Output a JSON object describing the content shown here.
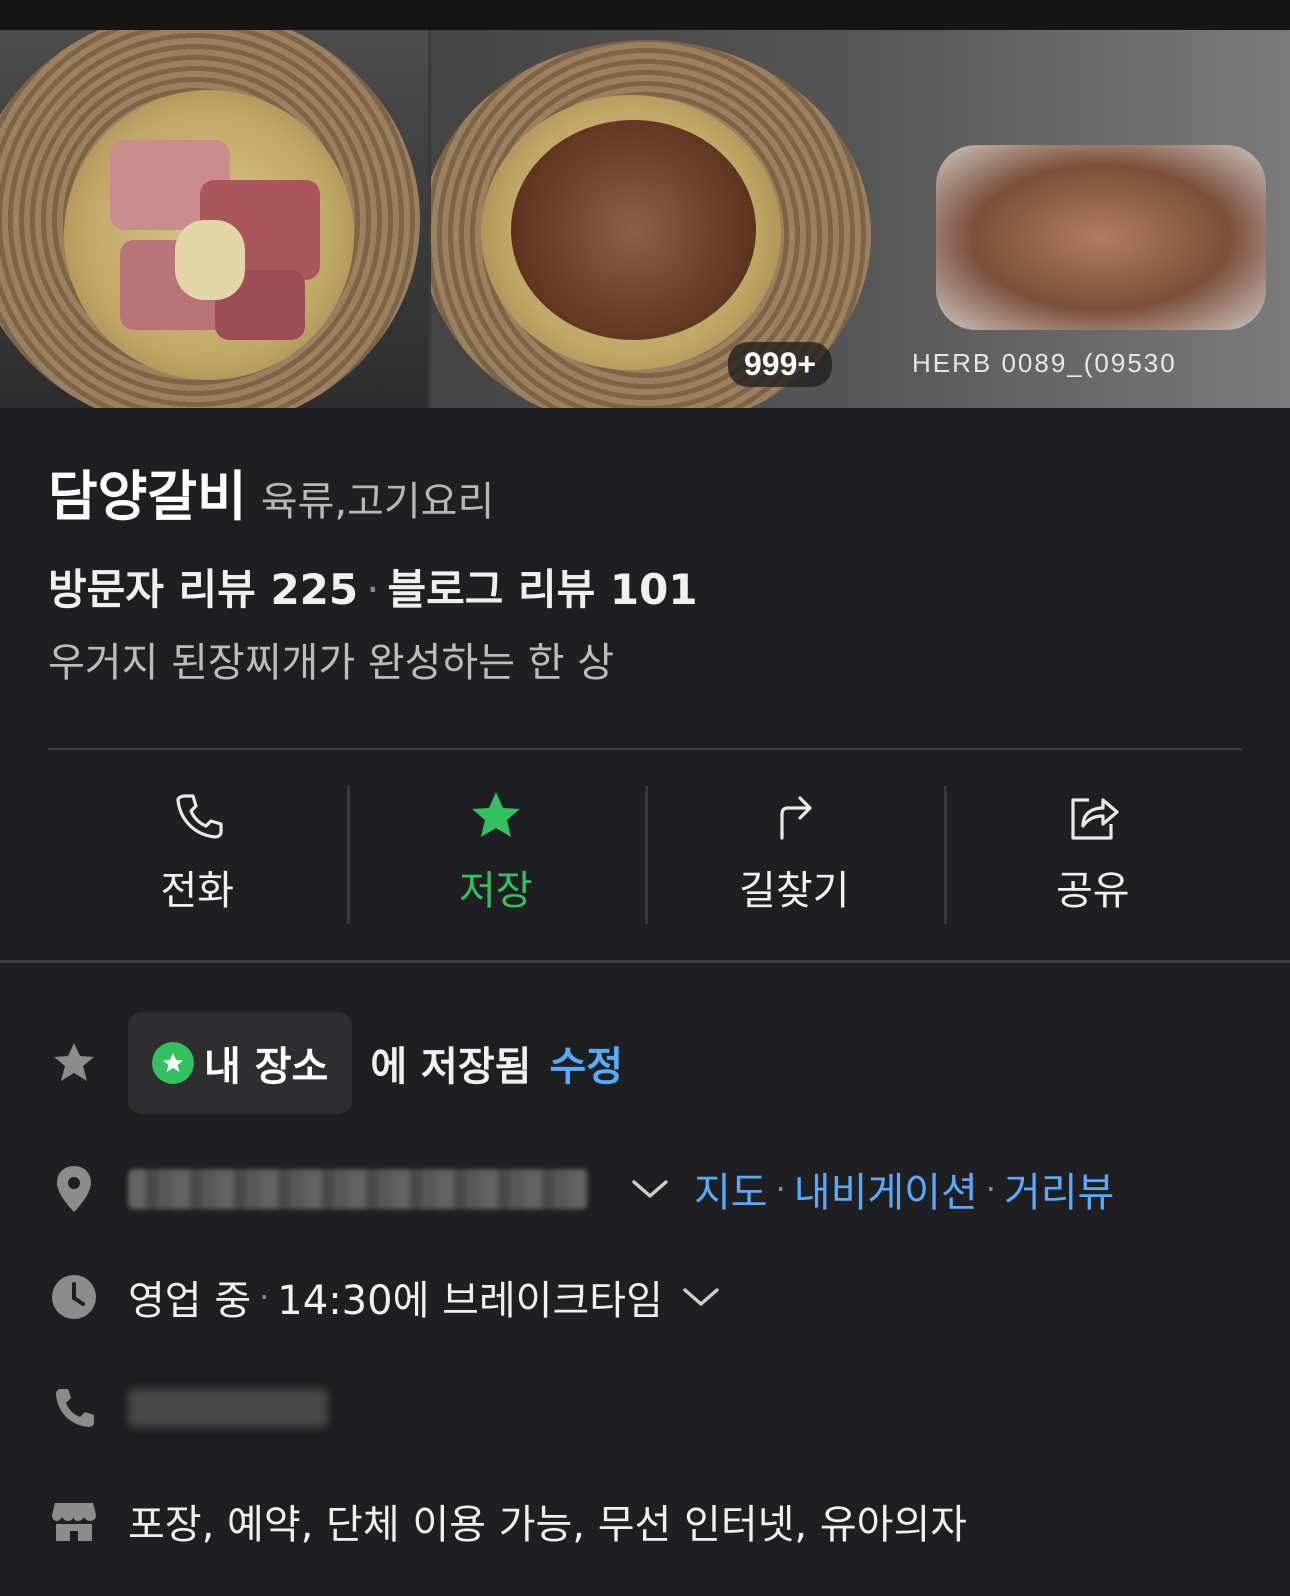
{
  "gallery": {
    "photo_count_badge": "999+",
    "photo_credit": "HERB 0089_(09530",
    "photos": [
      "raw-beef-rib-plate-photo",
      "marinated-galbi-plate-photo",
      "galbi-packaging-photo"
    ]
  },
  "place": {
    "name": "담양갈비",
    "category": "육류,고기요리",
    "visitor_reviews_label": "방문자 리뷰 225",
    "review_separator": "·",
    "blog_reviews_label": "블로그 리뷰 101",
    "description": "우거지 된장찌개가 완성하는 한 상"
  },
  "actions": [
    {
      "label": "전화",
      "icon": "phone-icon"
    },
    {
      "label": "저장",
      "icon": "star-icon"
    },
    {
      "label": "길찾기",
      "icon": "directions-icon"
    },
    {
      "label": "공유",
      "icon": "share-icon"
    }
  ],
  "saved": {
    "chip_label": "내 장소",
    "saved_text": "에 저장됨",
    "edit_label": "수정"
  },
  "address": {
    "map_label": "지도",
    "navigation_label": "내비게이션",
    "streetview_label": "거리뷰",
    "separator": "·"
  },
  "hours": {
    "status": "영업 중",
    "separator": "·",
    "break_info": "14:30에 브레이크타임"
  },
  "amenities": {
    "text": "포장, 예약, 단체 이용 가능, 무선 인터넷, 유아의자"
  },
  "colors": {
    "background": "#1f1f21",
    "accent_green": "#33c160",
    "link_blue": "#59a9ff"
  }
}
